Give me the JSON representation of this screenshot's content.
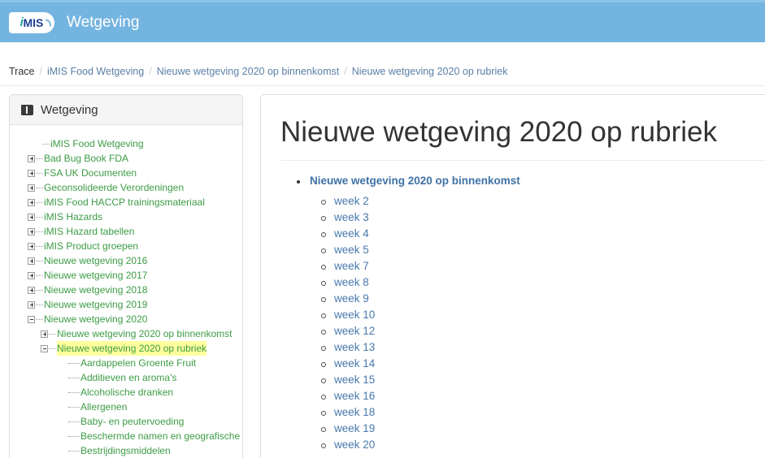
{
  "header": {
    "logo_i": "i",
    "logo_mis": "MIS",
    "title": "Wetgeving",
    "bg_color": "#74b4e0"
  },
  "breadcrumb": {
    "label": "Trace",
    "separator": "/",
    "items": [
      "iMIS Food Wetgeving",
      "Nieuwe wetgeving 2020 op binnenkomst",
      "Nieuwe wetgeving 2020 op rubriek"
    ]
  },
  "sidebar": {
    "panel_title": "Wetgeving",
    "icon": "book-icon",
    "highlight_color": "#ffff9e",
    "link_color": "#3c9c45",
    "tree": [
      {
        "label": "iMIS Food Wetgeving",
        "level": 0,
        "toggle": "none",
        "selected": false
      },
      {
        "label": "Bad Bug Book FDA",
        "level": 1,
        "toggle": "plus",
        "selected": false
      },
      {
        "label": "FSA UK Documenten",
        "level": 1,
        "toggle": "plus",
        "selected": false
      },
      {
        "label": "Geconsolideerde Verordeningen",
        "level": 1,
        "toggle": "plus",
        "selected": false
      },
      {
        "label": "iMIS Food HACCP trainingsmateriaal",
        "level": 1,
        "toggle": "plus",
        "selected": false
      },
      {
        "label": "iMIS Hazards",
        "level": 1,
        "toggle": "plus",
        "selected": false
      },
      {
        "label": "iMIS Hazard tabellen",
        "level": 1,
        "toggle": "plus",
        "selected": false
      },
      {
        "label": "iMIS Product groepen",
        "level": 1,
        "toggle": "plus",
        "selected": false
      },
      {
        "label": "Nieuwe wetgeving 2016",
        "level": 1,
        "toggle": "plus",
        "selected": false
      },
      {
        "label": "Nieuwe wetgeving 2017",
        "level": 1,
        "toggle": "plus",
        "selected": false
      },
      {
        "label": "Nieuwe wetgeving 2018",
        "level": 1,
        "toggle": "plus",
        "selected": false
      },
      {
        "label": "Nieuwe wetgeving 2019",
        "level": 1,
        "toggle": "plus",
        "selected": false
      },
      {
        "label": "Nieuwe wetgeving 2020",
        "level": 1,
        "toggle": "minus",
        "selected": false
      },
      {
        "label": "Nieuwe wetgeving 2020 op binnenkomst",
        "level": 2,
        "toggle": "plus",
        "selected": false
      },
      {
        "label": "Nieuwe wetgeving 2020 op rubriek",
        "level": 2,
        "toggle": "minus",
        "selected": true
      },
      {
        "label": "Aardappelen Groente Fruit",
        "level": 3,
        "toggle": "none",
        "selected": false
      },
      {
        "label": "Additieven en aroma's",
        "level": 3,
        "toggle": "none",
        "selected": false
      },
      {
        "label": "Alcoholische dranken",
        "level": 3,
        "toggle": "none",
        "selected": false
      },
      {
        "label": "Allergenen",
        "level": 3,
        "toggle": "none",
        "selected": false
      },
      {
        "label": "Baby- en peutervoeding",
        "level": 3,
        "toggle": "none",
        "selected": false
      },
      {
        "label": "Beschermde namen en geografische",
        "level": 3,
        "toggle": "none",
        "selected": false
      },
      {
        "label": "Bestrijdingsmiddelen",
        "level": 3,
        "toggle": "none",
        "selected": false
      }
    ]
  },
  "main": {
    "title": "Nieuwe wetgeving 2020 op rubriek",
    "top_link": "Nieuwe wetgeving 2020 op binnenkomst",
    "link_color": "#4779ad",
    "weeks": [
      "week 2",
      "week 3",
      "week 4",
      "week 5",
      "week 7",
      "week 8",
      "week 9",
      "week 10",
      "week 12",
      "week 13",
      "week 14",
      "week 15",
      "week 16",
      "week 18",
      "week 19",
      "week 20"
    ]
  }
}
